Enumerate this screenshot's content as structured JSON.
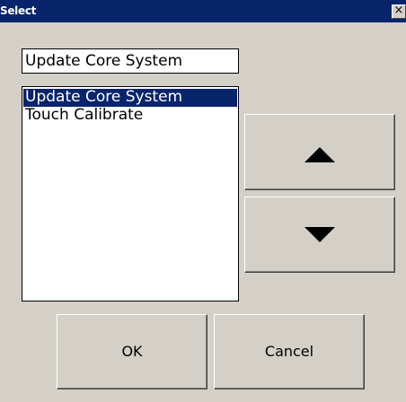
{
  "window": {
    "title": "Select",
    "close_glyph": "×"
  },
  "textbox": {
    "value": "Update Core System"
  },
  "listbox": {
    "items": [
      {
        "label": "Update Core System",
        "selected": true
      },
      {
        "label": "Touch Calibrate",
        "selected": false
      }
    ]
  },
  "buttons": {
    "move_up_icon": "triangle-up-icon",
    "move_down_icon": "triangle-down-icon",
    "ok_label": "OK",
    "cancel_label": "Cancel"
  },
  "colors": {
    "titlebar": "#08246b",
    "selection": "#08246b",
    "dialog_face": "#d4d0c8"
  }
}
